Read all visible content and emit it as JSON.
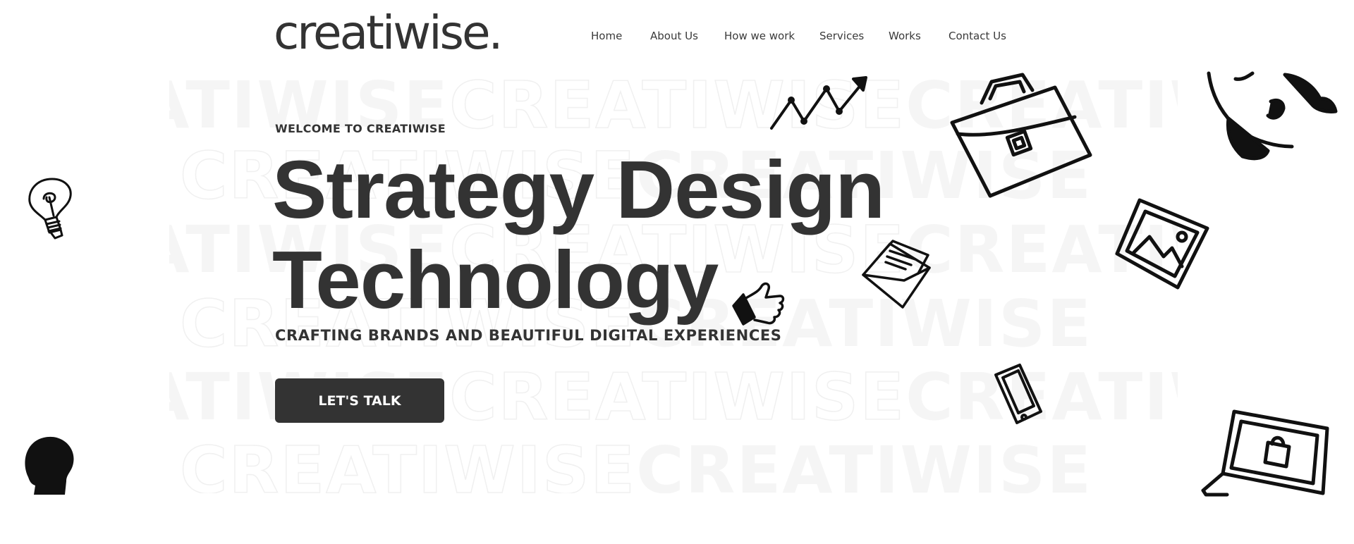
{
  "header": {
    "logo_text": "creatiwise.",
    "nav": [
      {
        "label": "Home"
      },
      {
        "label": "About Us"
      },
      {
        "label": "How we work"
      },
      {
        "label": "Services"
      },
      {
        "label": "Works"
      },
      {
        "label": "Contact Us"
      }
    ]
  },
  "hero": {
    "watermark_word": "CREATIWISE",
    "welcome": "WELCOME TO CREATIWISE",
    "title_line1": "Strategy Design",
    "title_line2": "Technology",
    "tagline": "CRAFTING BRANDS AND BEAUTIFUL DIGITAL EXPERIENCES",
    "cta_label": "LET'S TALK"
  },
  "doodles": [
    {
      "name": "lightbulb-icon"
    },
    {
      "name": "head-silhouette-icon"
    },
    {
      "name": "trend-arrow-icon"
    },
    {
      "name": "thumbs-up-icon"
    },
    {
      "name": "envelope-icon"
    },
    {
      "name": "briefcase-icon"
    },
    {
      "name": "picture-frame-icon"
    },
    {
      "name": "smartphone-icon"
    },
    {
      "name": "rocket-icon"
    },
    {
      "name": "laptop-shopping-icon"
    }
  ],
  "colors": {
    "text": "#333333",
    "background": "#ffffff",
    "button_bg": "#333333",
    "button_text": "#ffffff",
    "watermark": "#f5f5f5"
  }
}
